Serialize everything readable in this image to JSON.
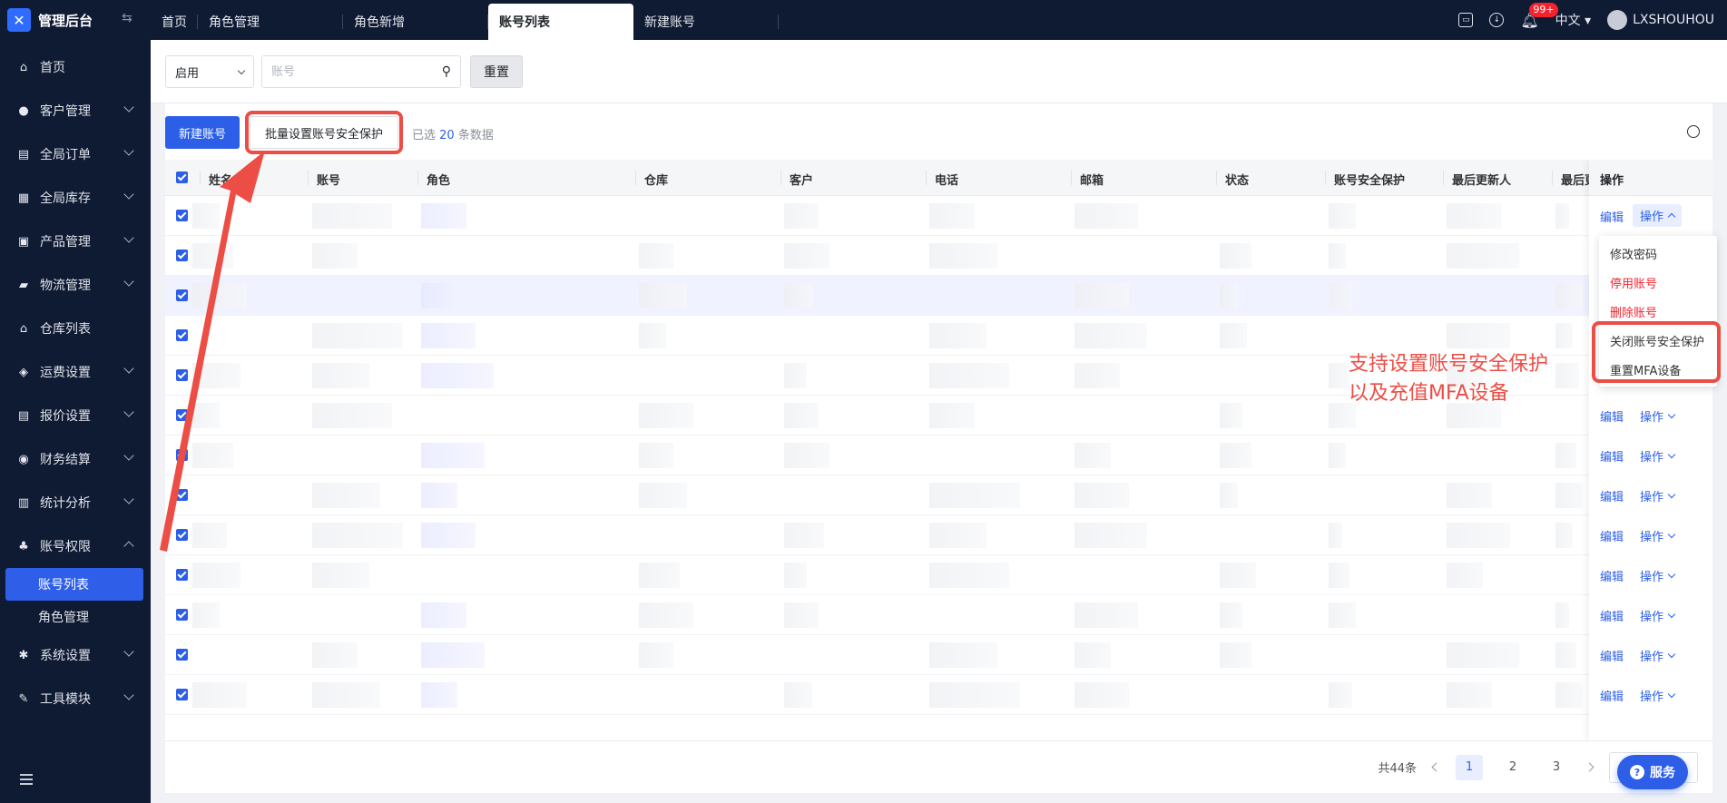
{
  "app": {
    "title": "管理后台"
  },
  "sidebar": {
    "items": [
      {
        "label": "首页",
        "icon": "home-icon"
      },
      {
        "label": "客户管理",
        "icon": "users-icon"
      },
      {
        "label": "全局订单",
        "icon": "clipboard-icon"
      },
      {
        "label": "全局库存",
        "icon": "warehouse-icon"
      },
      {
        "label": "产品管理",
        "icon": "box-icon"
      },
      {
        "label": "物流管理",
        "icon": "truck-icon"
      },
      {
        "label": "仓库列表",
        "icon": "building-icon"
      },
      {
        "label": "运费设置",
        "icon": "package-icon"
      },
      {
        "label": "报价设置",
        "icon": "document-icon"
      },
      {
        "label": "财务结算",
        "icon": "coin-icon"
      },
      {
        "label": "统计分析",
        "icon": "chart-icon"
      },
      {
        "label": "账号权限",
        "icon": "org-icon"
      },
      {
        "label": "系统设置",
        "icon": "gear-icon"
      },
      {
        "label": "工具模块",
        "icon": "wrench-icon"
      }
    ],
    "sub_items": [
      "账号列表",
      "角色管理"
    ]
  },
  "tabs": [
    "首页",
    "角色管理",
    "角色新增",
    "账号列表",
    "新建账号"
  ],
  "topbar": {
    "badge": "99+",
    "language": "中文",
    "username": "LXSHOUHOU"
  },
  "filter": {
    "status_value": "启用",
    "account_placeholder": "账号",
    "reset_label": "重置"
  },
  "toolbar": {
    "new_account": "新建账号",
    "batch_security": "批量设置账号安全保护",
    "selected_prefix": "已选",
    "selected_count": "20",
    "selected_suffix": "条数据"
  },
  "table": {
    "columns": [
      "姓名",
      "账号",
      "角色",
      "仓库",
      "客户",
      "电话",
      "邮箱",
      "状态",
      "账号安全保护",
      "最后更新人",
      "最后更"
    ],
    "op_column": "操作",
    "edit_label": "编辑",
    "op_label": "操作"
  },
  "dropdown": [
    "修改密码",
    "停用账号",
    "删除账号",
    "关闭账号安全保护",
    "重置MFA设备"
  ],
  "annotation": {
    "line1": "支持设置账号安全保护",
    "line2": "以及充值MFA设备"
  },
  "pagination": {
    "total": "共44条",
    "pages": [
      "1",
      "2",
      "3"
    ]
  },
  "service": {
    "label": "服务",
    "icon_glyph": "?"
  },
  "colors": {
    "primary": "#2c5ee8",
    "sidebar": "#0f1a33",
    "annotation": "#ec4d45",
    "danger": "#f5222d"
  }
}
